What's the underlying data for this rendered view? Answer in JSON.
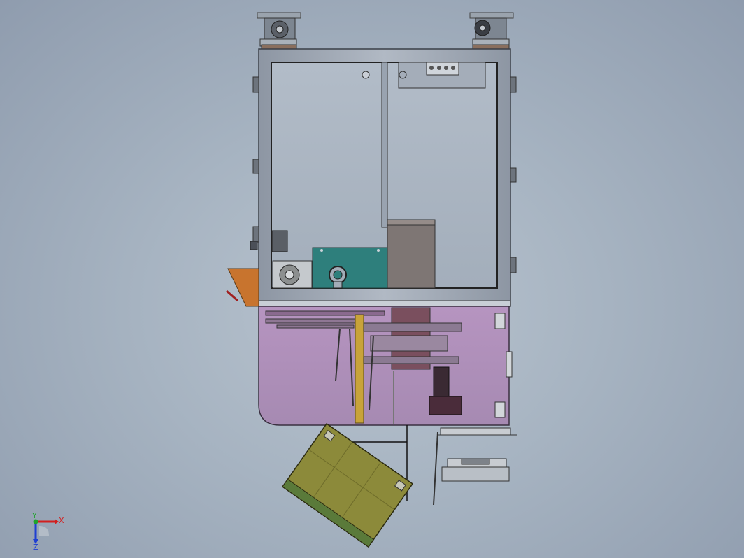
{
  "viewport": {
    "background_top": "#8f9cae",
    "background_center": "#b9c4cf"
  },
  "model": {
    "parts": [
      {
        "name": "frame",
        "color": "#a7b0bd"
      },
      {
        "name": "lower-enclosure",
        "color": "#a98bb5"
      },
      {
        "name": "tilted-panel",
        "color": "#8c8a3a"
      },
      {
        "name": "teal-block",
        "color": "#2e7f7c"
      },
      {
        "name": "grey-box",
        "color": "#7e7674"
      },
      {
        "name": "orange-bracket",
        "color": "#c8742e"
      }
    ]
  },
  "triad": {
    "x_label": "X",
    "y_label": "Y",
    "z_label": "Z",
    "x_color": "#d21f1f",
    "y_color": "#1fa32b",
    "z_color": "#1f3fd2"
  }
}
